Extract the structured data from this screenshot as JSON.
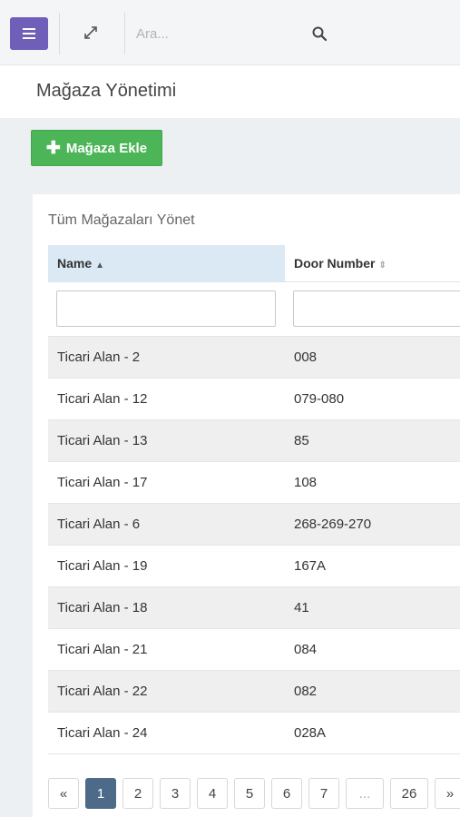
{
  "topbar": {
    "search_placeholder": "Ara..."
  },
  "header": {
    "page_title": "Mağaza Yönetimi"
  },
  "toolbar": {
    "add_store_label": "Mağaza Ekle"
  },
  "panel": {
    "title": "Tüm Mağazaları Yönet"
  },
  "table": {
    "columns": [
      "Name",
      "Door Number"
    ],
    "rows": [
      {
        "name": "Ticari Alan - 2",
        "door": "008"
      },
      {
        "name": "Ticari Alan - 12",
        "door": "079-080"
      },
      {
        "name": "Ticari Alan - 13",
        "door": "85"
      },
      {
        "name": "Ticari Alan - 17",
        "door": "108"
      },
      {
        "name": "Ticari Alan - 6",
        "door": "268-269-270"
      },
      {
        "name": "Ticari Alan - 19",
        "door": "167A"
      },
      {
        "name": "Ticari Alan - 18",
        "door": "41"
      },
      {
        "name": "Ticari Alan - 21",
        "door": "084"
      },
      {
        "name": "Ticari Alan - 22",
        "door": "082"
      },
      {
        "name": "Ticari Alan - 24",
        "door": "028A"
      }
    ]
  },
  "pagination": {
    "prev": "«",
    "pages": [
      "1",
      "2",
      "3",
      "4",
      "5",
      "6",
      "7"
    ],
    "ellipsis": "...",
    "last": "26",
    "next": "»",
    "current": "1"
  },
  "colors": {
    "menu_button": "#6f5fb8",
    "add_button": "#4cb557",
    "active_page": "#4d6a88",
    "sorted_header": "#dbe9f5"
  }
}
